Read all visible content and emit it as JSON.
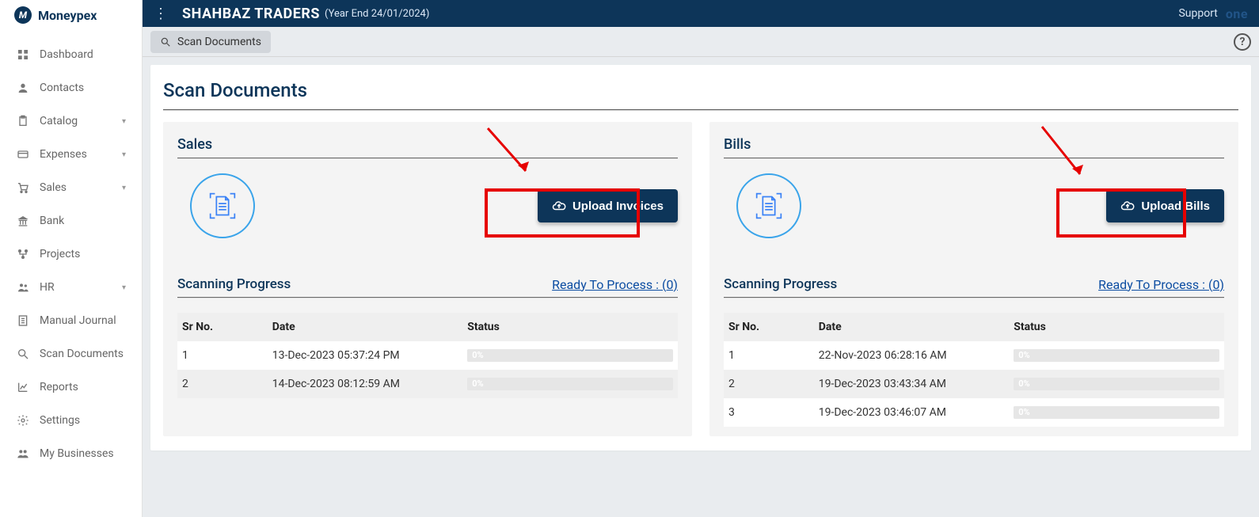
{
  "brand": "Moneypex",
  "header": {
    "company": "SHAHBAZ TRADERS",
    "year_end": "(Year End 24/01/2024)",
    "support": "Support",
    "suffix": "one"
  },
  "breadcrumb": {
    "label": "Scan Documents"
  },
  "help_glyph": "?",
  "sidebar": {
    "items": [
      {
        "icon": "dashboard",
        "label": "Dashboard",
        "caret": false
      },
      {
        "icon": "user",
        "label": "Contacts",
        "caret": false
      },
      {
        "icon": "clipboard",
        "label": "Catalog",
        "caret": true
      },
      {
        "icon": "card",
        "label": "Expenses",
        "caret": true
      },
      {
        "icon": "cart",
        "label": "Sales",
        "caret": true
      },
      {
        "icon": "bank",
        "label": "Bank",
        "caret": false
      },
      {
        "icon": "branch",
        "label": "Projects",
        "caret": false
      },
      {
        "icon": "people",
        "label": "HR",
        "caret": true
      },
      {
        "icon": "journal",
        "label": "Manual Journal",
        "caret": false
      },
      {
        "icon": "search",
        "label": "Scan Documents",
        "caret": false
      },
      {
        "icon": "chart",
        "label": "Reports",
        "caret": false
      },
      {
        "icon": "gear",
        "label": "Settings",
        "caret": false
      },
      {
        "icon": "biz",
        "label": "My Businesses",
        "caret": false
      }
    ]
  },
  "page": {
    "title": "Scan Documents",
    "panels": {
      "sales": {
        "title": "Sales",
        "upload_label": "Upload Invoices",
        "progress_title": "Scanning Progress",
        "ready_link": "Ready To Process : (0)",
        "columns": {
          "sr": "Sr No.",
          "date": "Date",
          "status": "Status"
        },
        "rows": [
          {
            "sr": "1",
            "date": "13-Dec-2023 05:37:24 PM",
            "pct": "0%"
          },
          {
            "sr": "2",
            "date": "14-Dec-2023 08:12:59 AM",
            "pct": "0%"
          }
        ]
      },
      "bills": {
        "title": "Bills",
        "upload_label": "Upload Bills",
        "progress_title": "Scanning Progress",
        "ready_link": "Ready To Process : (0)",
        "columns": {
          "sr": "Sr No.",
          "date": "Date",
          "status": "Status"
        },
        "rows": [
          {
            "sr": "1",
            "date": "22-Nov-2023 06:28:16 AM",
            "pct": "0%"
          },
          {
            "sr": "2",
            "date": "19-Dec-2023 03:43:34 AM",
            "pct": "0%"
          },
          {
            "sr": "3",
            "date": "19-Dec-2023 03:46:07 AM",
            "pct": "0%"
          }
        ]
      }
    }
  }
}
